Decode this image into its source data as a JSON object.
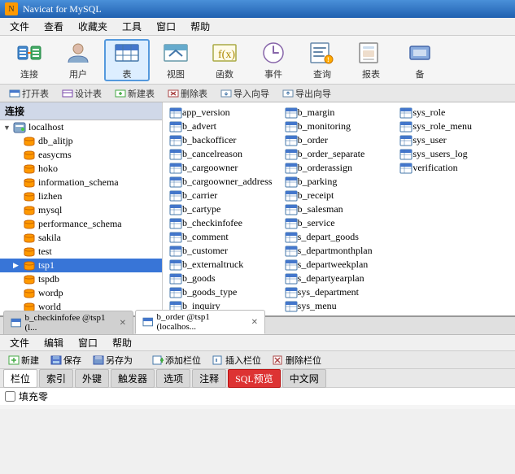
{
  "titleBar": {
    "title": "Navicat for MySQL",
    "icon": "N"
  },
  "menuBar": {
    "items": [
      "文件",
      "查看",
      "收藏夹",
      "工具",
      "窗口",
      "帮助"
    ]
  },
  "toolbar": {
    "buttons": [
      {
        "id": "connect",
        "label": "连接",
        "icon": "connect"
      },
      {
        "id": "user",
        "label": "用户",
        "icon": "user"
      },
      {
        "id": "table",
        "label": "表",
        "icon": "table",
        "active": true
      },
      {
        "id": "view",
        "label": "视图",
        "icon": "view"
      },
      {
        "id": "function",
        "label": "函数",
        "icon": "function"
      },
      {
        "id": "event",
        "label": "事件",
        "icon": "event"
      },
      {
        "id": "query",
        "label": "查询",
        "icon": "query"
      },
      {
        "id": "report",
        "label": "报表",
        "icon": "report"
      },
      {
        "id": "backup",
        "label": "备",
        "icon": "backup"
      }
    ]
  },
  "connToolbar": {
    "buttons": [
      "打开表",
      "设计表",
      "新建表",
      "删除表",
      "导入向导",
      "导出向导"
    ]
  },
  "sidebar": {
    "header": "连接",
    "items": [
      {
        "id": "localhost",
        "label": "localhost",
        "level": 0,
        "type": "server",
        "expanded": true
      },
      {
        "id": "db_alitjp",
        "label": "db_alitjp",
        "level": 1,
        "type": "db"
      },
      {
        "id": "easycms",
        "label": "easycms",
        "level": 1,
        "type": "db"
      },
      {
        "id": "hoko",
        "label": "hoko",
        "level": 1,
        "type": "db"
      },
      {
        "id": "information_schema",
        "label": "information_schema",
        "level": 1,
        "type": "db"
      },
      {
        "id": "lizhen",
        "label": "lizhen",
        "level": 1,
        "type": "db"
      },
      {
        "id": "mysql",
        "label": "mysql",
        "level": 1,
        "type": "db"
      },
      {
        "id": "performance_schema",
        "label": "performance_schema",
        "level": 1,
        "type": "db"
      },
      {
        "id": "sakila",
        "label": "sakila",
        "level": 1,
        "type": "db"
      },
      {
        "id": "test",
        "label": "test",
        "level": 1,
        "type": "db"
      },
      {
        "id": "tsp1",
        "label": "tsp1",
        "level": 1,
        "type": "db",
        "selected": true
      },
      {
        "id": "tspdb",
        "label": "tspdb",
        "level": 1,
        "type": "db"
      },
      {
        "id": "wordp",
        "label": "wordp",
        "level": 1,
        "type": "db"
      },
      {
        "id": "world",
        "label": "world",
        "level": 1,
        "type": "db"
      }
    ]
  },
  "tableList": {
    "tables": [
      "app_version",
      "b_advert",
      "b_backofficer",
      "b_cancelreason",
      "b_cargoowner",
      "b_cargoowner_address",
      "b_carrier",
      "b_cartype",
      "b_checkinfofee",
      "b_comment",
      "b_customer",
      "b_externaltruck",
      "b_goods",
      "b_goods_type",
      "b_inquiry",
      "b_margin",
      "b_monitoring",
      "b_order",
      "b_order_separate",
      "b_orderassign",
      "b_parking",
      "b_receipt",
      "b_salesman",
      "b_service",
      "s_depart_goods",
      "s_departmonthplan",
      "s_departweekplan",
      "s_departyearplan",
      "sys_department",
      "sys_menu",
      "sys_role",
      "sys_role_menu",
      "sys_user",
      "sys_users_log",
      "verification"
    ]
  },
  "bottomSection": {
    "tabs": [
      {
        "id": "checkinfofee",
        "label": "b_checkinfofee @tsp1 (l...",
        "active": false
      },
      {
        "id": "border",
        "label": "b_order @tsp1 (localhos...",
        "active": true
      }
    ],
    "menuItems": [
      "文件",
      "编辑",
      "窗口",
      "帮助"
    ],
    "toolbarButtons": [
      "新建",
      "保存",
      "另存为",
      "添加栏位",
      "插入栏位",
      "删除栏位"
    ],
    "subTabs": [
      "栏位",
      "索引",
      "外键",
      "触发器",
      "选项",
      "注释",
      "SQL预览",
      "中文网"
    ],
    "activeSubTab": "栏位",
    "fieldLabel": "填充零"
  }
}
